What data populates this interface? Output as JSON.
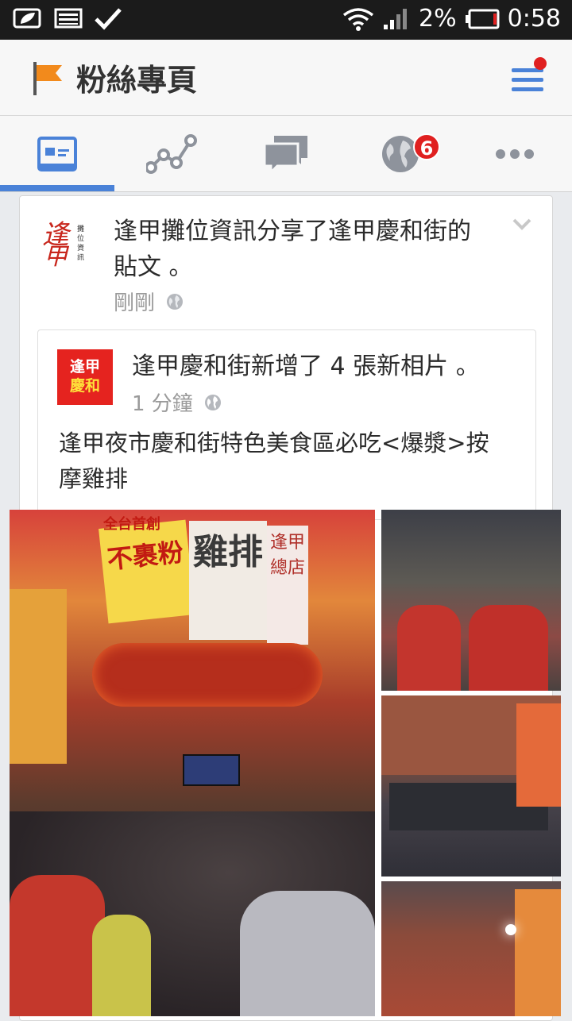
{
  "status_bar": {
    "battery_percent": "2%",
    "time": "0:58"
  },
  "app_bar": {
    "title": "粉絲專頁",
    "menu_has_notification": true
  },
  "tabs": [
    {
      "name": "news-feed",
      "active": true
    },
    {
      "name": "insights",
      "active": false
    },
    {
      "name": "messages",
      "active": false
    },
    {
      "name": "notifications",
      "badge": "6"
    },
    {
      "name": "more",
      "active": false
    }
  ],
  "post": {
    "header": "逢甲攤位資訊分享了逢甲慶和街的貼文 。",
    "time": "剛剛",
    "logo_text": "逢甲攤位資訊"
  },
  "shared_post": {
    "logo_line1": "逢甲",
    "logo_line2": "慶和",
    "title": "逢甲慶和街新增了 4 張新相片 。",
    "time": "1 分鐘",
    "text": "逢甲夜市慶和街特色美食區必吃<爆漿>按摩雞排"
  },
  "photo_signs": {
    "sign1": "不裹粉",
    "sign2": "雞排",
    "sign3": "逢甲總店",
    "sign4": "全台首創"
  },
  "colors": {
    "accent": "#4a82d8",
    "badge": "#e02020",
    "flag": "#f28a1c"
  }
}
